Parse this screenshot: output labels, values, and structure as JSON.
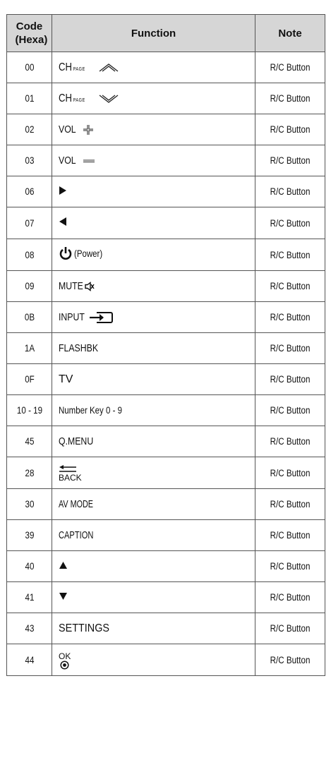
{
  "table": {
    "headers": {
      "code": "Code (Hexa)",
      "function": "Function",
      "note": "Note"
    },
    "rows": [
      {
        "code": "00",
        "function": "CH PAGE",
        "icon": "chevron-up-icon",
        "note": "R/C Button"
      },
      {
        "code": "01",
        "function": "CH PAGE",
        "icon": "chevron-down-icon",
        "note": "R/C Button"
      },
      {
        "code": "02",
        "function": "VOL",
        "icon": "plus-icon",
        "note": "R/C Button"
      },
      {
        "code": "03",
        "function": "VOL",
        "icon": "minus-icon",
        "note": "R/C Button"
      },
      {
        "code": "06",
        "function": "",
        "icon": "triangle-right-icon",
        "note": "R/C Button"
      },
      {
        "code": "07",
        "function": "",
        "icon": "triangle-left-icon",
        "note": "R/C Button"
      },
      {
        "code": "08",
        "function": "(Power)",
        "icon": "power-icon",
        "note": "R/C Button"
      },
      {
        "code": "09",
        "function": "MUTE",
        "icon": "mute-icon",
        "note": "R/C Button"
      },
      {
        "code": "0B",
        "function": "INPUT",
        "icon": "input-icon",
        "note": "R/C Button"
      },
      {
        "code": "1A",
        "function": "FLASHBK",
        "icon": "",
        "note": "R/C Button"
      },
      {
        "code": "0F",
        "function": "TV",
        "icon": "",
        "note": "R/C Button"
      },
      {
        "code": "10 - 19",
        "function": "Number Key 0 - 9",
        "icon": "",
        "note": "R/C Button"
      },
      {
        "code": "45",
        "function": "Q.MENU",
        "icon": "",
        "note": "R/C Button"
      },
      {
        "code": "28",
        "function": "BACK",
        "icon": "back-arrow-icon",
        "note": "R/C Button"
      },
      {
        "code": "30",
        "function": "AV MODE",
        "icon": "",
        "note": "R/C Button"
      },
      {
        "code": "39",
        "function": "CAPTION",
        "icon": "",
        "note": "R/C Button"
      },
      {
        "code": "40",
        "function": "",
        "icon": "triangle-up-icon",
        "note": "R/C Button"
      },
      {
        "code": "41",
        "function": "",
        "icon": "triangle-down-icon",
        "note": "R/C Button"
      },
      {
        "code": "43",
        "function": "SETTINGS",
        "icon": "",
        "note": "R/C Button"
      },
      {
        "code": "44",
        "function": "OK",
        "icon": "ok-circle-icon",
        "note": "R/C Button"
      }
    ]
  }
}
